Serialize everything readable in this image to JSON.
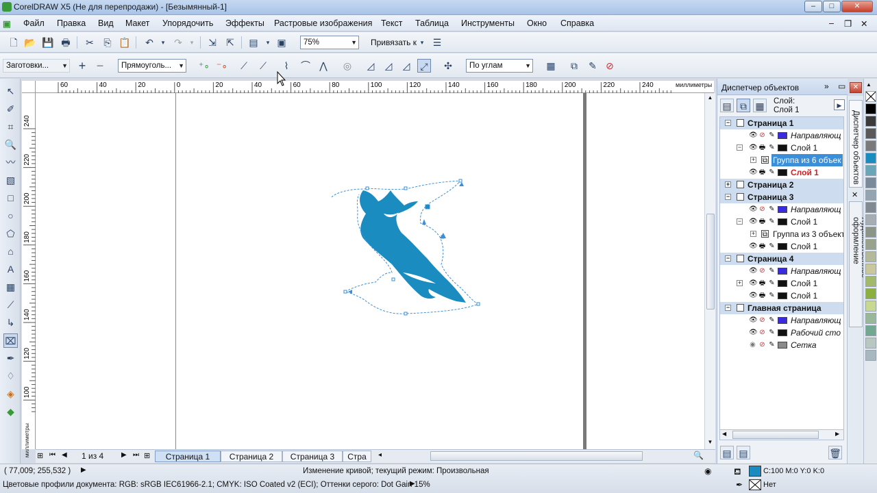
{
  "window": {
    "title": "CorelDRAW X5 (Не для перепродажи) - [Безымянный-1]"
  },
  "menu": [
    "Файл",
    "Правка",
    "Вид",
    "Макет",
    "Упорядочить",
    "Эффекты",
    "Растровые изображения",
    "Текст",
    "Таблица",
    "Инструменты",
    "Окно",
    "Справка"
  ],
  "toolbar": {
    "zoom": "75%",
    "snap": "Привязать к"
  },
  "property_bar": {
    "presets": "Заготовки...",
    "selection_mode": "Прямоуголь...",
    "node_mode": "По углам"
  },
  "ruler": {
    "h_labels": [
      "60",
      "40",
      "20",
      "0",
      "20",
      "40",
      "60",
      "80",
      "100",
      "120",
      "140",
      "160",
      "180",
      "200",
      "220",
      "240"
    ],
    "h_unit": "миллиметры",
    "v_labels": [
      "240",
      "220",
      "200",
      "180",
      "160",
      "140",
      "120",
      "100"
    ],
    "v_unit": "миллиметры"
  },
  "page_nav": {
    "counter": "1 из 4",
    "tabs": [
      "Страница 1",
      "Страница 2",
      "Страница 3",
      "Стра"
    ]
  },
  "docker": {
    "title": "Диспетчер объектов",
    "layer_label": "Слой:",
    "layer_name": "Слой 1",
    "rows": [
      {
        "text": "Страница 1",
        "type": "page"
      },
      {
        "text": "Направляющ",
        "type": "guides"
      },
      {
        "text": "Слой 1",
        "type": "layer"
      },
      {
        "text": "Группа из 6 объек",
        "type": "group-selected"
      },
      {
        "text": "Слой 1",
        "type": "layer-red"
      },
      {
        "text": "Страница 2",
        "type": "page"
      },
      {
        "text": "Страница 3",
        "type": "page"
      },
      {
        "text": "Направляющ",
        "type": "guides"
      },
      {
        "text": "Слой 1",
        "type": "layer"
      },
      {
        "text": "Группа из 3 объект",
        "type": "group"
      },
      {
        "text": "Слой 1",
        "type": "layer"
      },
      {
        "text": "Страница 4",
        "type": "page"
      },
      {
        "text": "Направляющ",
        "type": "guides"
      },
      {
        "text": "Слой 1",
        "type": "layer"
      },
      {
        "text": "Слой 1",
        "type": "layer"
      },
      {
        "text": "Главная страница",
        "type": "page"
      },
      {
        "text": "Направляющ",
        "type": "guides"
      },
      {
        "text": "Рабочий сто",
        "type": "desktop"
      },
      {
        "text": "Сетка",
        "type": "grid"
      }
    ]
  },
  "side_tabs": {
    "objects": "Диспетчер объектов",
    "artistic": "Художественное оформление"
  },
  "status": {
    "coords": "( 77,009; 255,532 )",
    "message": "Изменение кривой; текущий режим: Произвольная",
    "profiles": "Цветовые профили документа: RGB: sRGB IEC61966-2.1; CMYK: ISO Coated v2 (ECI); Оттенки серого: Dot Gain 15%",
    "fill": "C:100 M:0 Y:0 K:0",
    "outline": "Нет"
  },
  "colors": {
    "shape": "#1a8cc0",
    "fill_swatch": "#1a8cc0",
    "selection": "#3a8fd8"
  },
  "palette": [
    "#ffffff",
    "#000000",
    "#3b3b3b",
    "#5a5a5a",
    "#7a7a7a",
    "#1a8cc0",
    "#6aa6b8",
    "#7a8a9a",
    "#95a5b0",
    "#808a90",
    "#a6aeb3",
    "#8c9488",
    "#9aa28c",
    "#b4b99a",
    "#c8c89c",
    "#a2b86a",
    "#8cb040",
    "#c8d890",
    "#98b898",
    "#70a890",
    "#b8c8c0",
    "#a8b8c0"
  ]
}
